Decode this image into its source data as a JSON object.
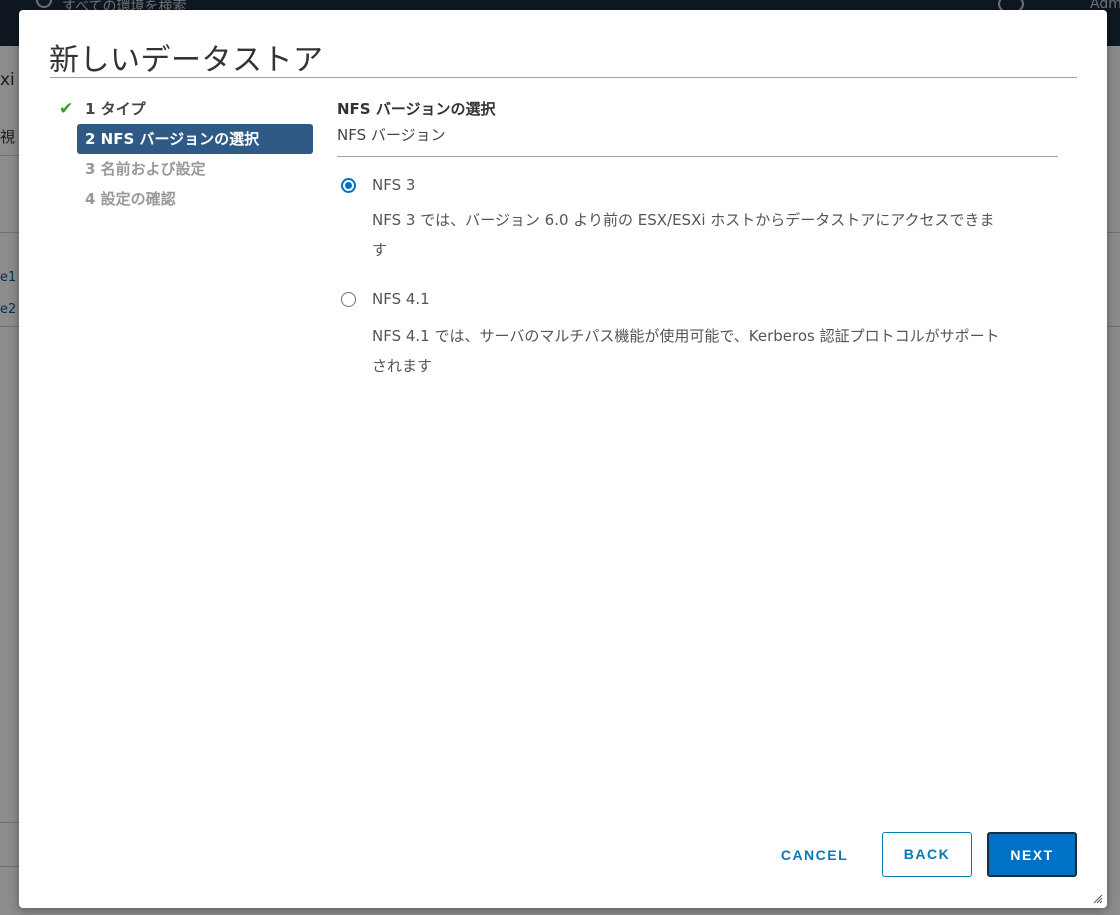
{
  "background": {
    "search_placeholder": "すべての環境を検索",
    "user_label": "Adm",
    "left_title": "xi",
    "left_tab": "視",
    "links": [
      "e1",
      "e2"
    ]
  },
  "dialog": {
    "title": "新しいデータストア",
    "steps": [
      {
        "label": "1 タイプ",
        "state": "done"
      },
      {
        "label": "2 NFS バージョンの選択",
        "state": "active"
      },
      {
        "label": "3 名前および設定",
        "state": "pending"
      },
      {
        "label": "4 設定の確認",
        "state": "pending"
      }
    ],
    "section_title": "NFS バージョンの選択",
    "section_subtitle": "NFS バージョン",
    "options": [
      {
        "label": "NFS 3",
        "selected": true,
        "description_line1": "NFS 3 では、バージョン 6.0 より前の ESX/ESXi ホストからデータストアにアクセスできま",
        "description_line2": "す"
      },
      {
        "label": "NFS 4.1",
        "selected": false,
        "description_line1": "NFS 4.1 では、サーバのマルチパス機能が使用可能で、Kerberos 認証プロトコルがサポート",
        "description_line2": "されます"
      }
    ],
    "buttons": {
      "cancel": "CANCEL",
      "back": "BACK",
      "next": "NEXT"
    }
  },
  "colors": {
    "accent": "#0072c6",
    "active_step": "#2f5a86",
    "check": "#3a9c2e",
    "topbar": "#1c2d3d"
  }
}
